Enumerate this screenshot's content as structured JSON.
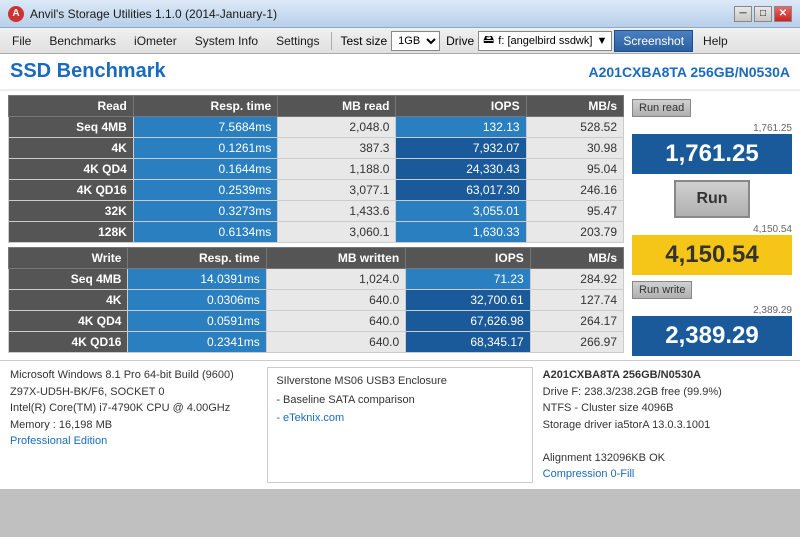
{
  "window": {
    "title": "Anvil's Storage Utilities 1.1.0 (2014-January-1)",
    "icon": "A"
  },
  "titlebar": {
    "minimize": "─",
    "maximize": "□",
    "close": "✕"
  },
  "menu": {
    "items": [
      "File",
      "Benchmarks",
      "iOmeter",
      "System Info",
      "Settings"
    ],
    "test_size_label": "Test size",
    "test_size_value": "1GB",
    "drive_label": "Drive",
    "drive_value": "f: [angelbird ssdwk]",
    "screenshot_label": "Screenshot",
    "help_label": "Help"
  },
  "header": {
    "title": "SSD Benchmark",
    "model": "A201CXBA8TA 256GB/N0530A"
  },
  "read_table": {
    "headers": [
      "Read",
      "Resp. time",
      "MB read",
      "IOPS",
      "MB/s"
    ],
    "rows": [
      {
        "label": "Seq 4MB",
        "resp": "7.5684ms",
        "mb": "2,048.0",
        "iops": "132.13",
        "mbs": "528.52"
      },
      {
        "label": "4K",
        "resp": "0.1261ms",
        "mb": "387.3",
        "iops": "7,932.07",
        "mbs": "30.98"
      },
      {
        "label": "4K QD4",
        "resp": "0.1644ms",
        "mb": "1,188.0",
        "iops": "24,330.43",
        "mbs": "95.04"
      },
      {
        "label": "4K QD16",
        "resp": "0.2539ms",
        "mb": "3,077.1",
        "iops": "63,017.30",
        "mbs": "246.16"
      },
      {
        "label": "32K",
        "resp": "0.3273ms",
        "mb": "1,433.6",
        "iops": "3,055.01",
        "mbs": "95.47"
      },
      {
        "label": "128K",
        "resp": "0.6134ms",
        "mb": "3,060.1",
        "iops": "1,630.33",
        "mbs": "203.79"
      }
    ]
  },
  "write_table": {
    "headers": [
      "Write",
      "Resp. time",
      "MB written",
      "IOPS",
      "MB/s"
    ],
    "rows": [
      {
        "label": "Seq 4MB",
        "resp": "14.0391ms",
        "mb": "1,024.0",
        "iops": "71.23",
        "mbs": "284.92"
      },
      {
        "label": "4K",
        "resp": "0.0306ms",
        "mb": "640.0",
        "iops": "32,700.61",
        "mbs": "127.74"
      },
      {
        "label": "4K QD4",
        "resp": "0.0591ms",
        "mb": "640.0",
        "iops": "67,626.98",
        "mbs": "264.17"
      },
      {
        "label": "4K QD16",
        "resp": "0.2341ms",
        "mb": "640.0",
        "iops": "68,345.17",
        "mbs": "266.97"
      }
    ]
  },
  "scores": {
    "run_read_label": "Run read",
    "run_label": "Run",
    "run_write_label": "Run write",
    "read_score_small": "1,761.25",
    "read_score_large": "1,761.25",
    "total_score_small": "4,150.54",
    "total_score_large": "4,150.54",
    "write_score_small": "2,389.29",
    "write_score_large": "2,389.29"
  },
  "bottom": {
    "sys_info": [
      "Microsoft Windows 8.1 Pro 64-bit Build (9600)",
      "Z97X-UD5H-BK/F6, SOCKET 0",
      "Intel(R) Core(TM) i7-4790K CPU @ 4.00GHz",
      "Memory : 16,198 MB"
    ],
    "pro_edition": "Professional Edition",
    "center_lines": [
      "SIlverstone MS06 USB3 Enclosure",
      "- Baseline SATA comparison",
      "- eTeknix.com"
    ],
    "drive_info": [
      "A201CXBA8TA 256GB/N0530A",
      "Drive F: 238.3/238.2GB free (99.9%)",
      "NTFS - Cluster size 4096B",
      "Storage driver  ia5torA 13.0.3.1001",
      "",
      "Alignment 132096KB OK",
      "Compression 0-Fill"
    ]
  }
}
